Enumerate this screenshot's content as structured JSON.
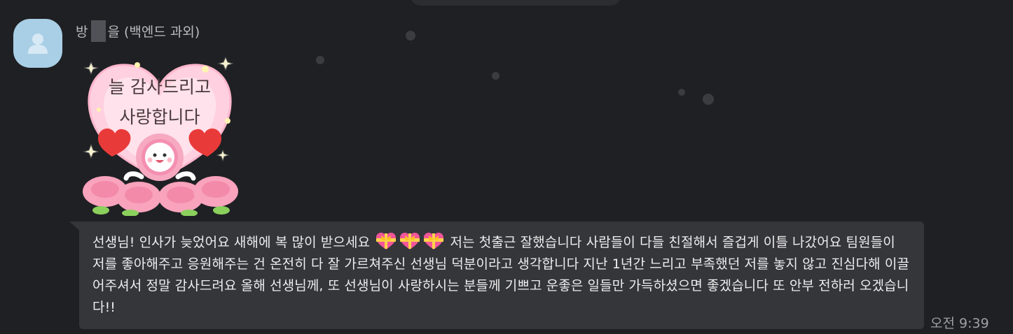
{
  "sender": {
    "name_prefix": "방",
    "name_suffix": "을 (백엔드 과외)"
  },
  "sticker": {
    "text_line1": "늘 감사드리고",
    "text_line2": "사랑합니다"
  },
  "message": {
    "part1": "선생님! 인사가 늦었어요 새해에 복 많이 받으세요",
    "part2": "저는 첫출근 잘했습니다 사람들이 다들 친절해서 즐겁게 이틀 나갔어요 팀원들이 저를 좋아해주고 응원해주는 건 온전히 다 잘 가르쳐주신 선생님 덕분이라고 생각합니다 지난 1년간 느리고 부족했던 저를 놓지 않고 진심다해 이끌어주셔서 정말 감사드려요 올해 선생님께, 또 선생님이 사랑하시는 분들께 기쁘고 운좋은 일들만 가득하셨으면 좋겠습니다 또 안부 전하러 오겠습니다!!",
    "emoji": [
      "heart-with-ribbon-icon",
      "heart-with-ribbon-icon",
      "heart-with-ribbon-icon"
    ],
    "time": "오전 9:39"
  },
  "colors": {
    "background": "#1f2023",
    "bubble": "#35363a",
    "avatar": "#a9cfe6"
  }
}
